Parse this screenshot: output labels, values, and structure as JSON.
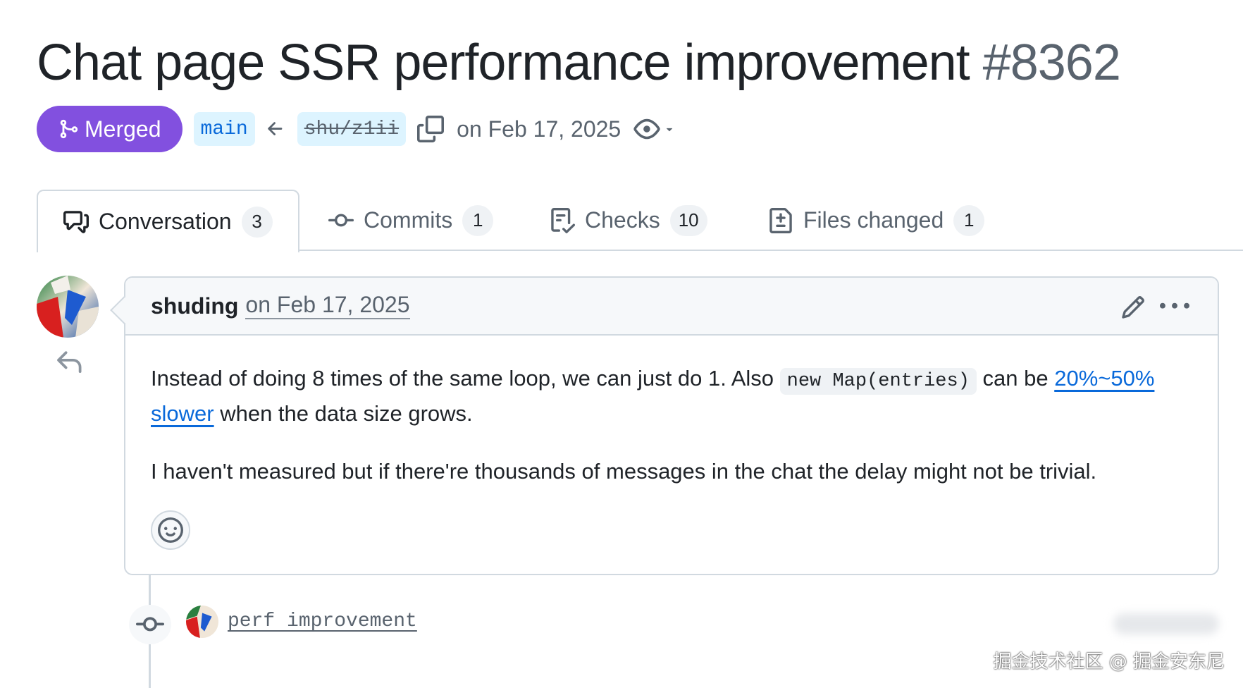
{
  "pr": {
    "title": "Chat page SSR performance improvement",
    "number": "#8362",
    "state": "Merged",
    "base_branch": "main",
    "head_branch": "shu/z1ii",
    "date": "on Feb 17, 2025"
  },
  "tabs": [
    {
      "label": "Conversation",
      "count": "3",
      "icon": "comment-discussion-icon"
    },
    {
      "label": "Commits",
      "count": "1",
      "icon": "git-commit-icon"
    },
    {
      "label": "Checks",
      "count": "10",
      "icon": "checklist-icon"
    },
    {
      "label": "Files changed",
      "count": "1",
      "icon": "file-diff-icon"
    }
  ],
  "comment": {
    "author": "shuding",
    "date": "on Feb 17, 2025",
    "para1_before": "Instead of doing 8 times of the same loop, we can just do 1. Also ",
    "para1_code": "new Map(entries)",
    "para1_mid": " can be ",
    "para1_link": "20%~50% slower",
    "para1_after": " when the data size grows.",
    "para2": "I haven't measured but if there're thousands of messages in the chat the delay might not be trivial."
  },
  "commit": {
    "message": "perf improvement"
  },
  "watermark": "掘金技术社区 @ 掘金安东尼",
  "colors": {
    "merged": "#8250df",
    "link": "#0969da",
    "branch_bg": "#ddf4ff",
    "border": "#d1d9e0"
  }
}
